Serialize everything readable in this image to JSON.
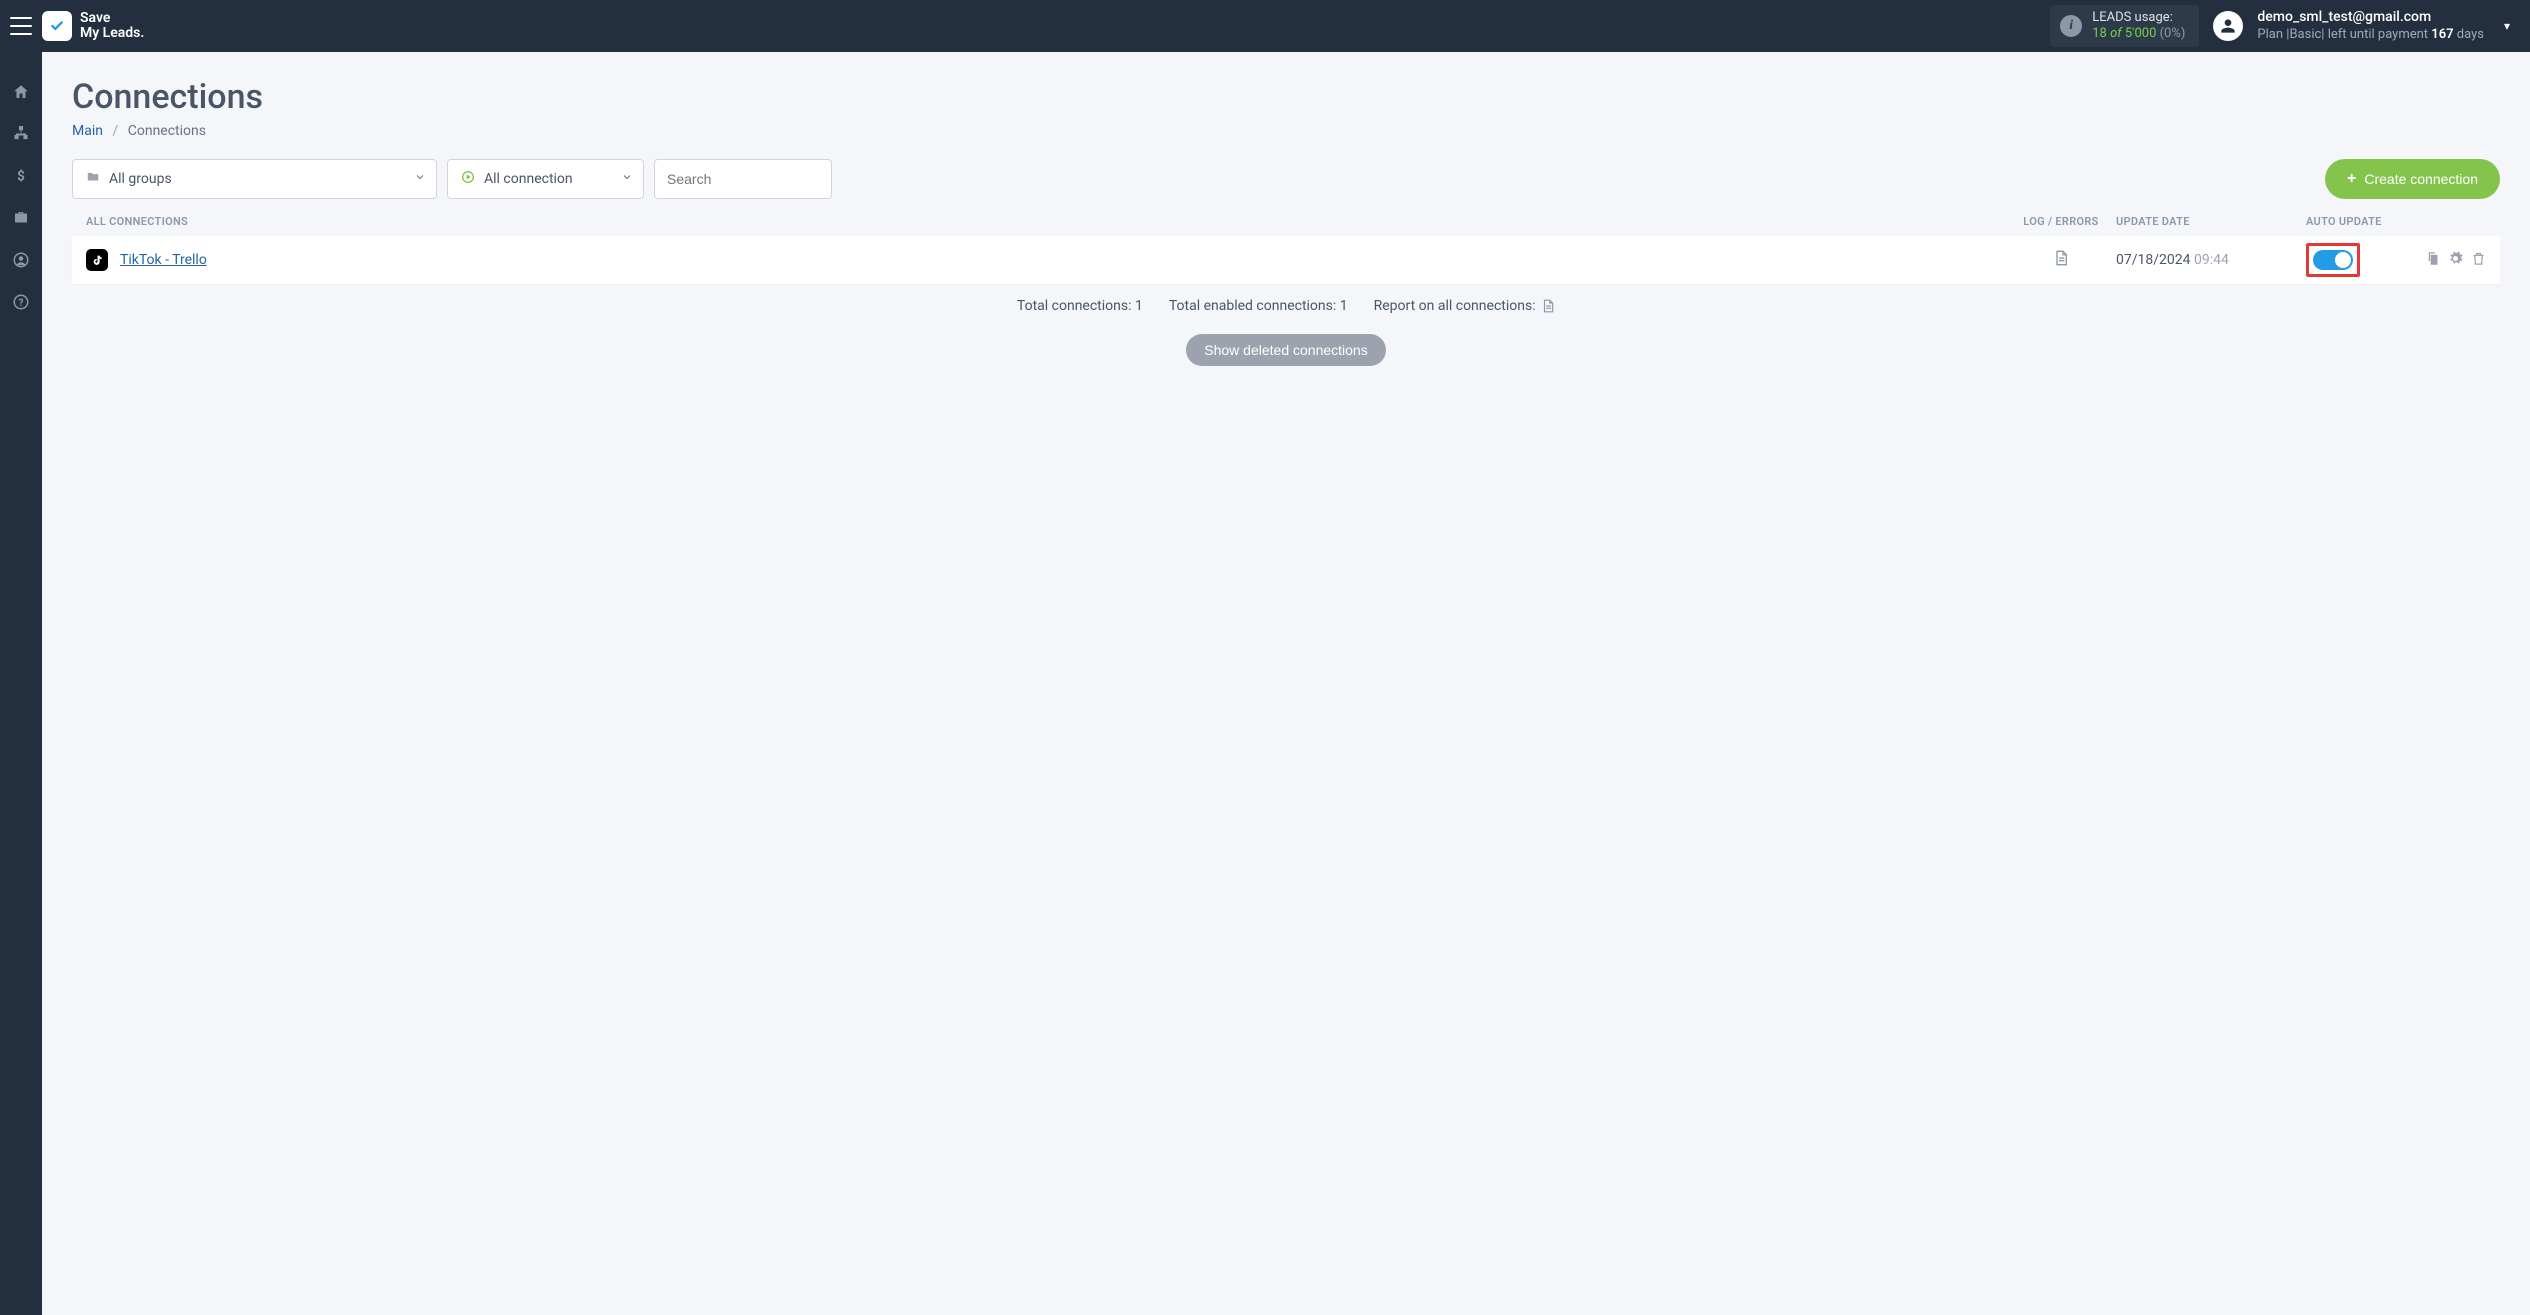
{
  "brand": {
    "line1": "Save",
    "line2": "My Leads."
  },
  "leads": {
    "label": "LEADS usage:",
    "used": "18",
    "of": "of",
    "total": "5'000",
    "pct": "(0%)"
  },
  "user": {
    "email": "demo_sml_test@gmail.com",
    "plan_prefix": "Plan |",
    "plan_name": "Basic",
    "plan_mid": "| left until payment ",
    "plan_days": "167",
    "plan_suffix": " days"
  },
  "page": {
    "title": "Connections",
    "breadcrumb_main": "Main",
    "breadcrumb_current": "Connections"
  },
  "filters": {
    "groups": "All groups",
    "status": "All connection",
    "search_placeholder": "Search"
  },
  "buttons": {
    "create": "Create connection",
    "show_deleted": "Show deleted connections"
  },
  "headers": {
    "name": "ALL CONNECTIONS",
    "log": "LOG / ERRORS",
    "update": "UPDATE DATE",
    "auto": "AUTO UPDATE"
  },
  "rows": [
    {
      "name": "TikTok - Trello",
      "date": "07/18/2024",
      "time": "09:44"
    }
  ],
  "summary": {
    "total_label": "Total connections: ",
    "total_val": "1",
    "enabled_label": "Total enabled connections: ",
    "enabled_val": "1",
    "report_label": "Report on all connections: "
  }
}
